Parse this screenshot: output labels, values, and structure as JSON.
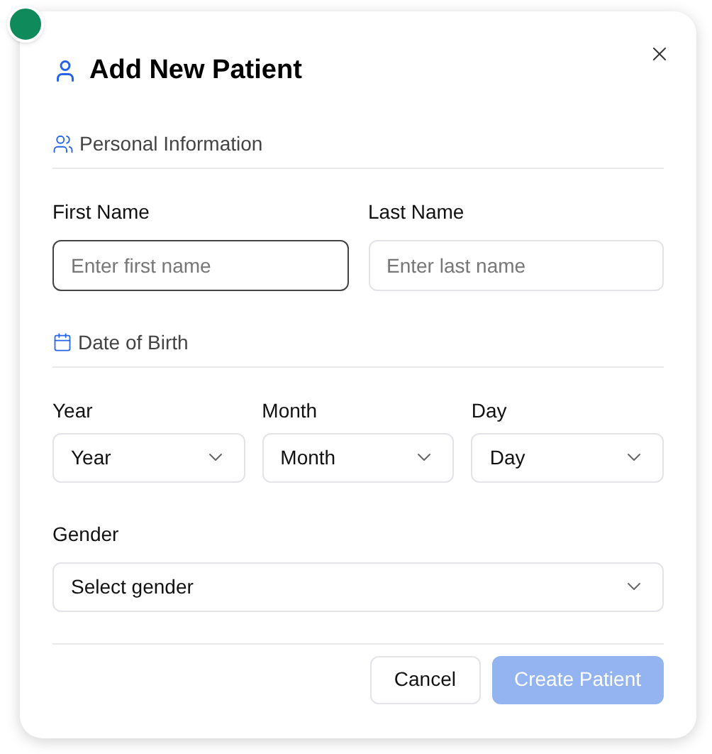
{
  "dialog": {
    "title": "Add New Patient"
  },
  "personal_section": {
    "heading": "Personal Information",
    "fields": [
      {
        "label": "First Name",
        "placeholder": "Enter first name",
        "focused": true
      },
      {
        "label": "Last Name",
        "placeholder": "Enter last name",
        "focused": false
      }
    ]
  },
  "birth_section": {
    "heading": "Date of Birth",
    "selects": [
      {
        "label": "Year",
        "value": "Year"
      },
      {
        "label": "Month",
        "value": "Month"
      },
      {
        "label": "Day",
        "value": "Day"
      }
    ]
  },
  "gender": {
    "label": "Gender",
    "value": "Select gender"
  },
  "buttons": [
    {
      "label": "Cancel",
      "kind": "secondary",
      "disabled": false
    },
    {
      "label": "Create Patient",
      "kind": "primary",
      "disabled": true
    }
  ]
}
